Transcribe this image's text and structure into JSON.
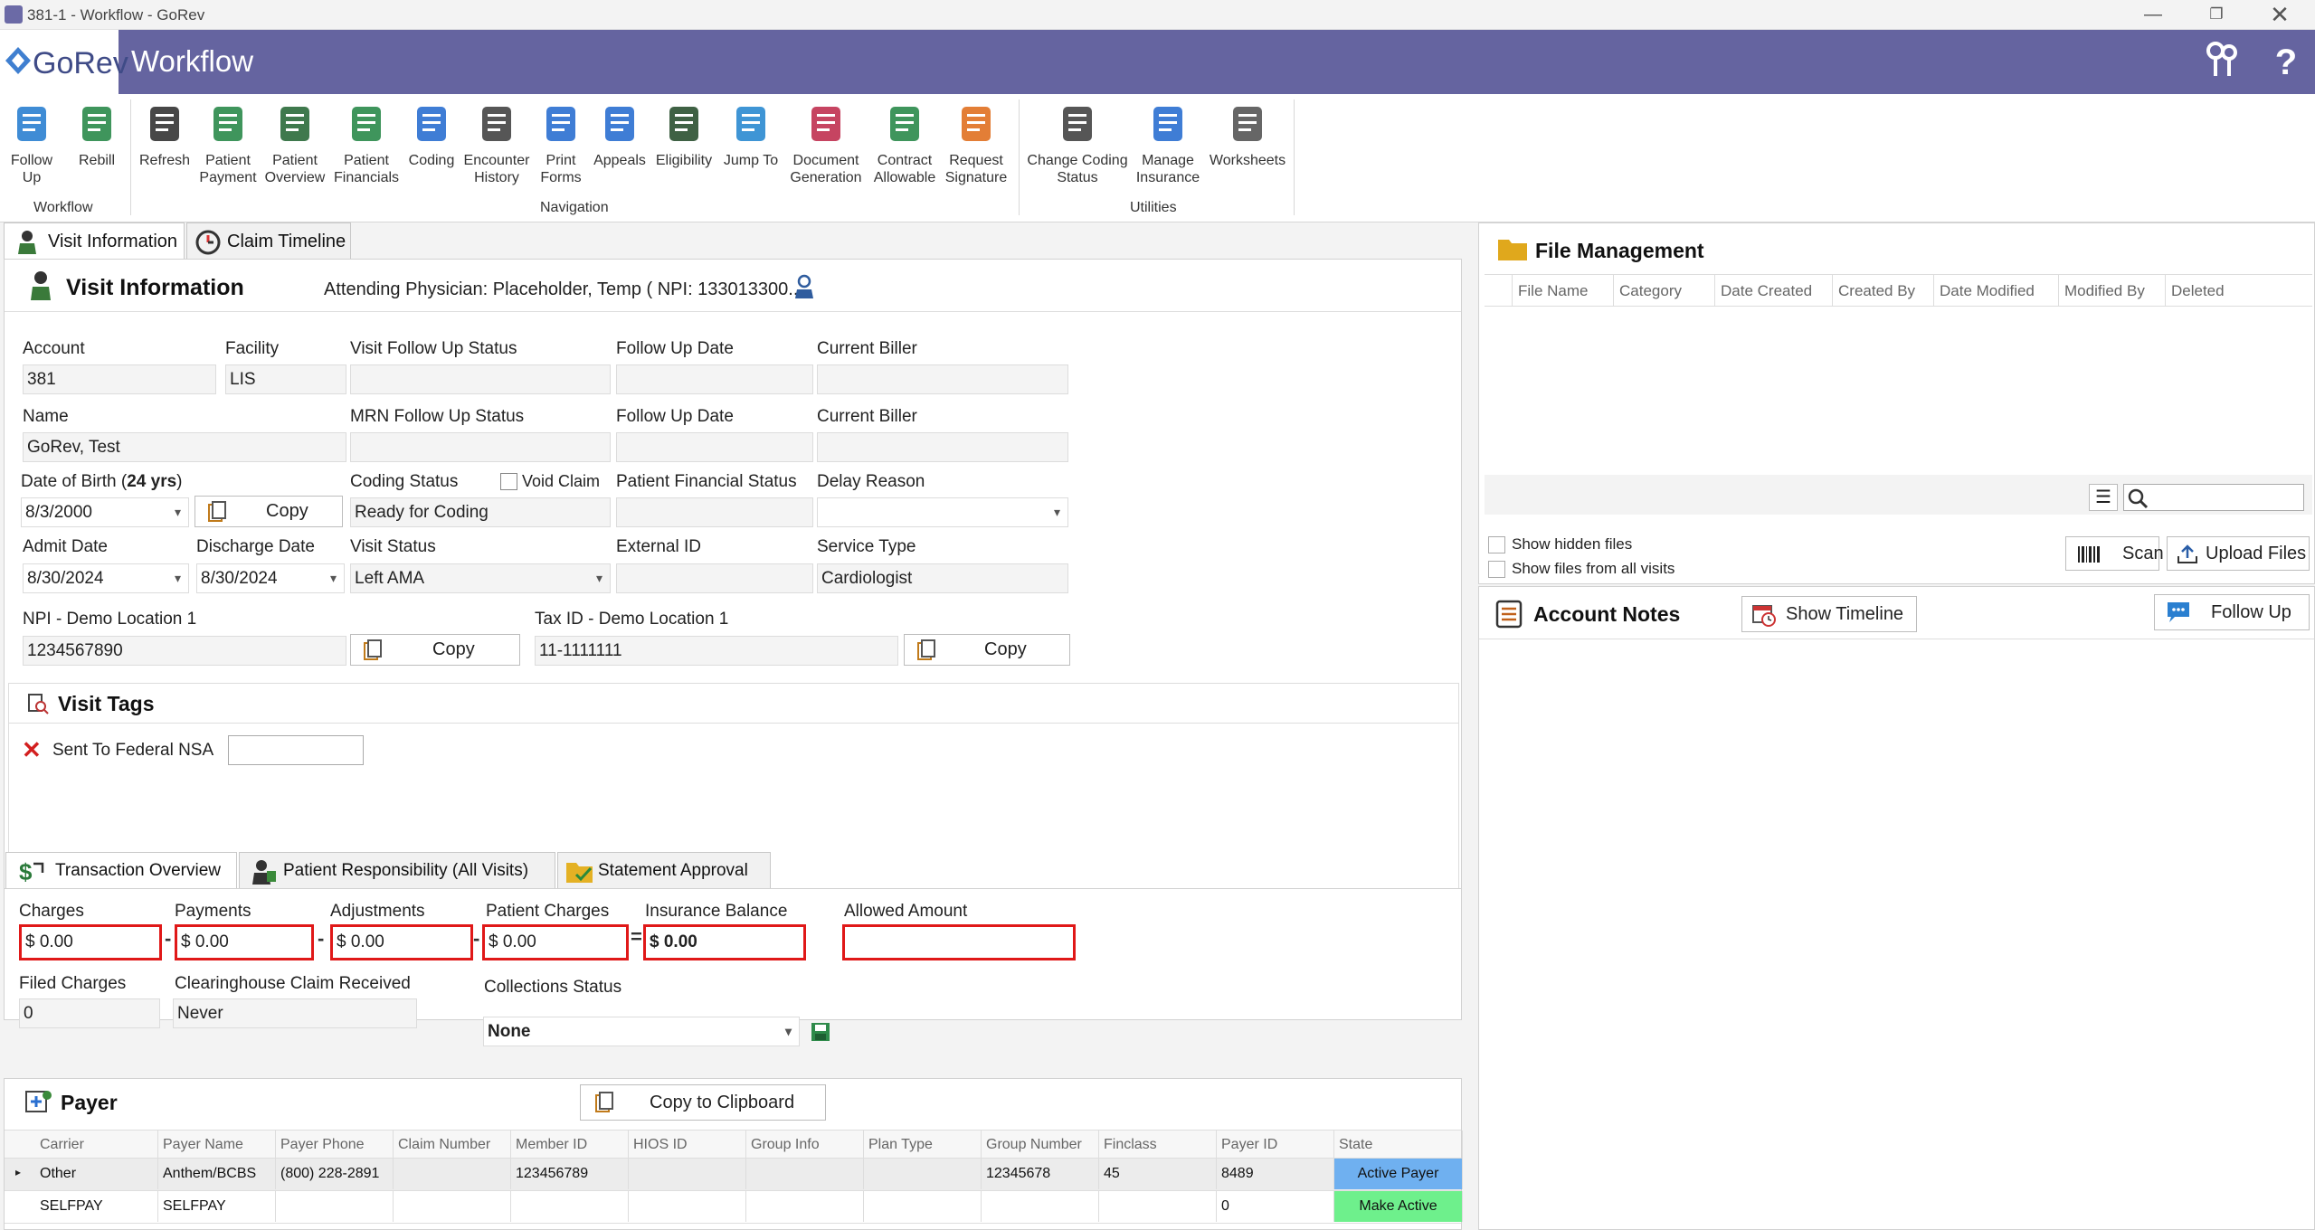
{
  "window": {
    "title": "381-1 - Workflow - GoRev"
  },
  "header": {
    "logo_text": "GoRev",
    "title": "Workflow"
  },
  "ribbon": {
    "items": [
      {
        "label": "Follow\nUp",
        "icon": "follow-up-icon"
      },
      {
        "label": "Rebill",
        "icon": "rebill-icon"
      },
      {
        "label": "Refresh",
        "icon": "refresh-icon"
      },
      {
        "label": "Patient\nPayment",
        "icon": "patient-payment-icon"
      },
      {
        "label": "Patient\nOverview",
        "icon": "patient-overview-icon"
      },
      {
        "label": "Patient\nFinancials",
        "icon": "patient-financials-icon"
      },
      {
        "label": "Coding",
        "icon": "coding-icon"
      },
      {
        "label": "Encounter\nHistory",
        "icon": "encounter-history-icon"
      },
      {
        "label": "Print\nForms",
        "icon": "print-icon"
      },
      {
        "label": "Appeals",
        "icon": "appeals-icon"
      },
      {
        "label": "Eligibility",
        "icon": "eligibility-icon"
      },
      {
        "label": "Jump To",
        "icon": "jump-to-icon"
      },
      {
        "label": "Document\nGeneration",
        "icon": "document-generation-icon"
      },
      {
        "label": "Contract\nAllowable",
        "icon": "contract-allowable-icon"
      },
      {
        "label": "Request\nSignature",
        "icon": "request-signature-icon"
      },
      {
        "label": "Change Coding\nStatus",
        "icon": "change-coding-status-icon"
      },
      {
        "label": "Manage\nInsurance",
        "icon": "manage-insurance-icon"
      },
      {
        "label": "Worksheets",
        "icon": "worksheets-icon"
      }
    ],
    "groups": {
      "workflow": "Workflow",
      "navigation": "Navigation",
      "utilities": "Utilities"
    }
  },
  "tabs": {
    "visit_information": "Visit Information",
    "claim_timeline": "Claim Timeline"
  },
  "visit": {
    "title": "Visit Information",
    "attending": "Attending Physician: Placeholder, Temp ( NPI: 133013300...",
    "labels": {
      "account": "Account",
      "facility": "Facility",
      "visit_follow_up_status": "Visit Follow Up Status",
      "follow_up_date": "Follow Up Date",
      "current_biller": "Current Biller",
      "name": "Name",
      "mrn_follow_up_status": "MRN Follow Up Status",
      "dob_prefix": "Date of Birth (",
      "dob_age": "24 yrs",
      "dob_suffix": ")",
      "coding_status": "Coding Status",
      "void_claim": "Void Claim",
      "patient_financial_status": "Patient Financial Status",
      "delay_reason": "Delay Reason",
      "admit_date": "Admit Date",
      "discharge_date": "Discharge Date",
      "visit_status": "Visit Status",
      "external_id": "External ID",
      "service_type": "Service Type",
      "npi": "NPI - Demo Location 1",
      "tax_id": "Tax ID - Demo Location 1"
    },
    "values": {
      "account": "381",
      "facility": "LIS",
      "visit_follow_up_status": "",
      "follow_up_date": "",
      "current_biller": "",
      "name": "GoRev, Test",
      "mrn_follow_up_status": "",
      "dob": "8/3/2000",
      "coding_status": "Ready for Coding",
      "patient_financial_status": "",
      "delay_reason": "",
      "admit_date": "8/30/2024",
      "discharge_date": "8/30/2024",
      "visit_status": "Left AMA",
      "external_id": "",
      "service_type": "Cardiologist",
      "npi": "1234567890",
      "tax_id": "11-1111111"
    },
    "copy_label": "Copy"
  },
  "visit_tags": {
    "title": "Visit Tags",
    "tag": "Sent To Federal NSA",
    "tag_value": ""
  },
  "tx_tabs": {
    "overview": "Transaction Overview",
    "patient_resp": "Patient Responsibility (All Visits)",
    "statement": "Statement Approval"
  },
  "transactions": {
    "labels": {
      "charges": "Charges",
      "payments": "Payments",
      "adjustments": "Adjustments",
      "patient_charges": "Patient Charges",
      "insurance_balance": "Insurance Balance",
      "allowed_amount": "Allowed Amount",
      "filed_charges": "Filed Charges",
      "clearinghouse": "Clearinghouse Claim Received",
      "collections_status": "Collections Status"
    },
    "values": {
      "charges": "$ 0.00",
      "payments": "$ 0.00",
      "adjustments": "$ 0.00",
      "patient_charges": "$ 0.00",
      "insurance_balance": "$ 0.00",
      "allowed_amount": "",
      "filed_charges": "0",
      "clearinghouse": "Never",
      "collections_status": "None"
    },
    "ops": {
      "minus": "-",
      "equals": "="
    }
  },
  "payer": {
    "title": "Payer",
    "copy_clipboard": "Copy to Clipboard",
    "columns": [
      "Carrier",
      "Payer Name",
      "Payer Phone",
      "Claim Number",
      "Member ID",
      "HIOS ID",
      "Group Info",
      "Plan Type",
      "Group Number",
      "Finclass",
      "Payer ID",
      "State"
    ],
    "rows": [
      {
        "carrier": "Other",
        "payer_name": "Anthem/BCBS",
        "payer_phone": "(800) 228-2891",
        "claim_number": "",
        "member_id": "123456789",
        "hios_id": "",
        "group_info": "",
        "plan_type": "",
        "group_number": "12345678",
        "finclass": "45",
        "payer_id": "8489",
        "state": "Active Payer",
        "state_color": "#6fb0f0"
      },
      {
        "carrier": "SELFPAY",
        "payer_name": "SELFPAY",
        "payer_phone": "",
        "claim_number": "",
        "member_id": "",
        "hios_id": "",
        "group_info": "",
        "plan_type": "",
        "group_number": "",
        "finclass": "",
        "payer_id": "0",
        "state": "Make Active",
        "state_color": "#6ef08c"
      }
    ]
  },
  "file_management": {
    "title": "File Management",
    "columns": [
      "File Name",
      "Category",
      "Date Created",
      "Created By",
      "Date Modified",
      "Modified By",
      "Deleted"
    ],
    "show_hidden": "Show hidden files",
    "show_all": "Show files from all visits",
    "scan": "Scan",
    "upload": "Upload Files",
    "search_placeholder": ""
  },
  "account_notes": {
    "title": "Account Notes",
    "show_timeline": "Show Timeline",
    "follow_up": "Follow Up"
  }
}
